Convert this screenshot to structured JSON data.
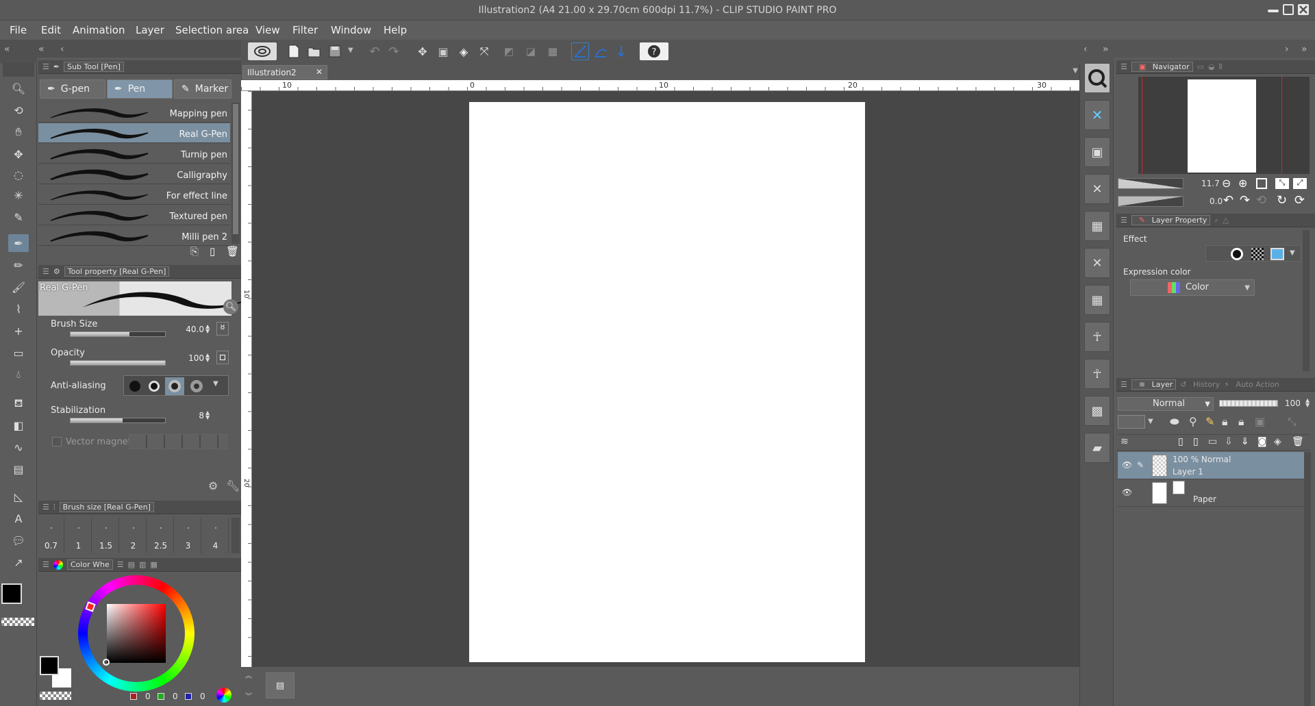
{
  "window": {
    "title": "Illustration2 (A4 21.00 x 29.70cm 600dpi 11.7%) - CLIP STUDIO PAINT PRO"
  },
  "menu": [
    "File",
    "Edit",
    "Animation",
    "Layer",
    "Selection area",
    "View",
    "Filter",
    "Window",
    "Help"
  ],
  "doc_tab": {
    "label": "Illustration2"
  },
  "ruler": {
    "h": [
      "10",
      "0",
      "10",
      "20",
      "30"
    ],
    "v": [
      "10",
      "20"
    ]
  },
  "subtool": {
    "header": "Sub Tool [Pen]",
    "tabs": [
      "G-pen",
      "Pen",
      "Marker"
    ],
    "selected_tab": "Pen",
    "brushes": [
      "Mapping pen",
      "Real G-Pen",
      "Turnip pen",
      "Calligraphy",
      "For effect line",
      "Textured pen",
      "Milli pen 2"
    ],
    "selected_brush": "Real G-Pen"
  },
  "tool_property": {
    "header": "Tool property [Real G-Pen]",
    "preview_name": "Real G-Pen",
    "brush_size_label": "Brush Size",
    "brush_size_value": "40.0",
    "brush_size_fraction": 0.62,
    "opacity_label": "Opacity",
    "opacity_value": "100",
    "opacity_fraction": 1.0,
    "antialias_label": "Anti-aliasing",
    "stabilization_label": "Stabilization",
    "stabilization_value": "8",
    "stabilization_fraction": 0.55,
    "vector_magnet_label": "Vector magnet"
  },
  "brush_size_palette": {
    "header": "Brush size [Real G-Pen]",
    "sizes": [
      "0.7",
      "1",
      "1.5",
      "2",
      "2.5",
      "3",
      "4"
    ]
  },
  "color_wheel": {
    "tab": "Color Whe",
    "r_value": "0",
    "g_value": "0",
    "b_value": "0",
    "main_color": "#000000",
    "sub_color": "#ffffff"
  },
  "navigator": {
    "tab": "Navigator",
    "zoom": "11.7",
    "rotation": "0.0"
  },
  "layer_property": {
    "tab": "Layer Property",
    "effect_label": "Effect",
    "expression_color_label": "Expression color",
    "expression_color_value": "Color"
  },
  "layer_panel": {
    "tabs": [
      "Layer",
      "History",
      "Auto Action"
    ],
    "blend_mode": "Normal",
    "opacity": "100",
    "layers": [
      {
        "line1": "100 % Normal",
        "line2": "Layer 1",
        "selected": true
      },
      {
        "line1": "",
        "line2": "Paper",
        "selected": false
      }
    ]
  },
  "colors": {
    "accent": "#7a8fa0",
    "bg": "#5f5f5f",
    "canvas_bg": "#474747"
  }
}
